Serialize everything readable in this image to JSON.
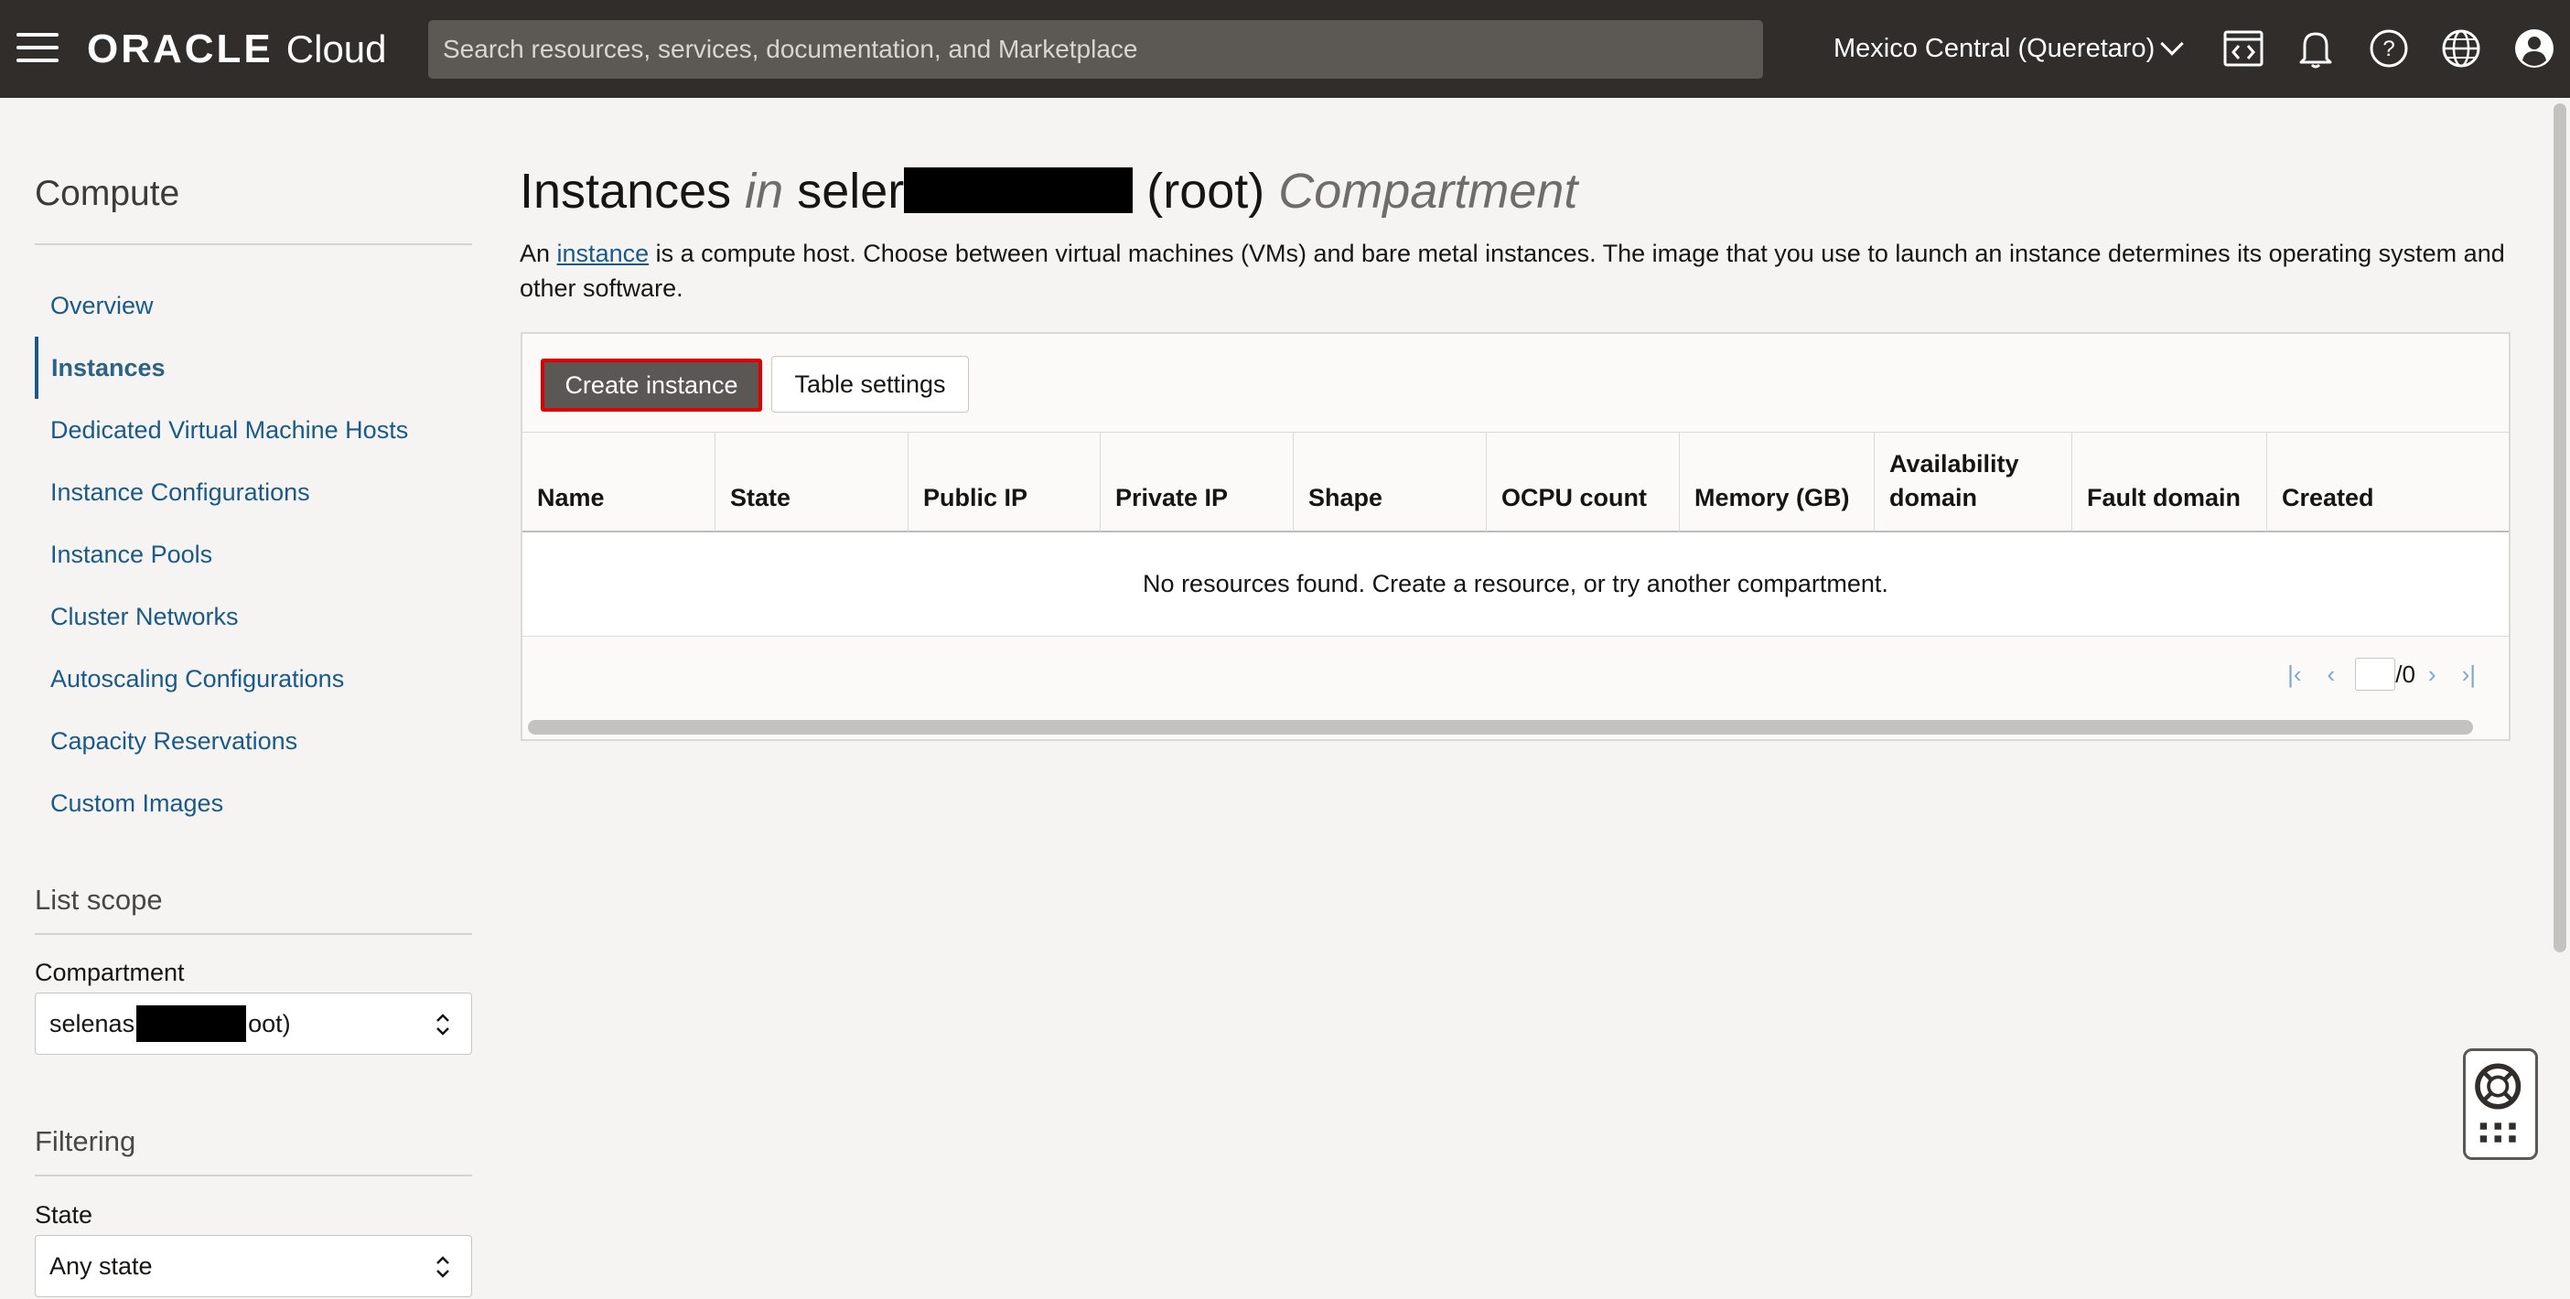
{
  "header": {
    "brand": "ORACLE",
    "product": "Cloud",
    "search_placeholder": "Search resources, services, documentation, and Marketplace",
    "region": "Mexico Central (Queretaro)"
  },
  "sidebar": {
    "title": "Compute",
    "items": [
      {
        "label": "Overview"
      },
      {
        "label": "Instances"
      },
      {
        "label": "Dedicated Virtual Machine Hosts"
      },
      {
        "label": "Instance Configurations"
      },
      {
        "label": "Instance Pools"
      },
      {
        "label": "Cluster Networks"
      },
      {
        "label": "Autoscaling Configurations"
      },
      {
        "label": "Capacity Reservations"
      },
      {
        "label": "Custom Images"
      }
    ],
    "list_scope_title": "List scope",
    "compartment_label": "Compartment",
    "compartment_value_start": "selenas",
    "compartment_value_end": "oot)",
    "filtering_title": "Filtering",
    "state_label": "State",
    "state_value": "Any state"
  },
  "main": {
    "title_instances": "Instances",
    "title_in": "in",
    "title_name": "seler",
    "title_root": "(root)",
    "title_compartment": "Compartment",
    "desc_prefix": "An",
    "desc_link": "instance",
    "desc_rest": "is a compute host. Choose between virtual machines (VMs) and bare metal instances. The image that you use to launch an instance determines its operating system and other software.",
    "create_button": "Create instance",
    "settings_button": "Table settings",
    "columns": [
      "Name",
      "State",
      "Public IP",
      "Private IP",
      "Shape",
      "OCPU count",
      "Memory (GB)",
      "Availability domain",
      "Fault domain",
      "Created"
    ],
    "empty_message": "No resources found. Create a resource, or try another compartment.",
    "pager_total": "/0"
  }
}
